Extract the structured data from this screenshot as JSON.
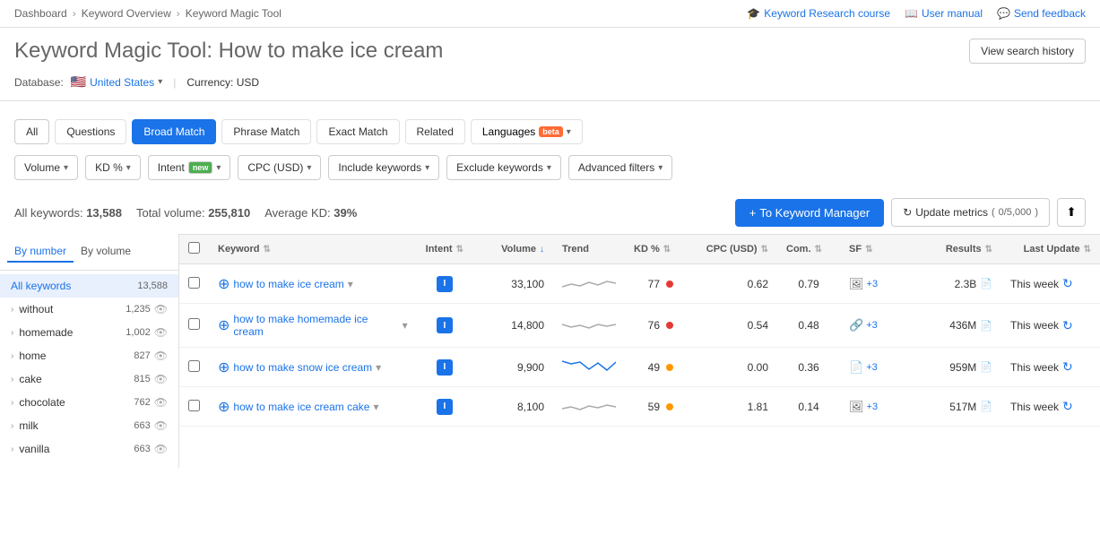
{
  "topNav": {
    "breadcrumbs": [
      "Dashboard",
      "Keyword Overview",
      "Keyword Magic Tool"
    ],
    "links": [
      {
        "label": "Keyword Research course",
        "icon": "graduation-cap"
      },
      {
        "label": "User manual",
        "icon": "book"
      },
      {
        "label": "Send feedback",
        "icon": "comment"
      }
    ]
  },
  "header": {
    "titleBold": "Keyword Magic Tool:",
    "titleLight": "How to make ice cream",
    "viewHistoryLabel": "View search history"
  },
  "database": {
    "label": "Database:",
    "country": "United States",
    "currency": "Currency: USD"
  },
  "matchTabs": [
    {
      "id": "all",
      "label": "All",
      "active": true
    },
    {
      "id": "questions",
      "label": "Questions",
      "active": false
    },
    {
      "id": "broad",
      "label": "Broad Match",
      "active": false
    },
    {
      "id": "phrase",
      "label": "Phrase Match",
      "active": false
    },
    {
      "id": "exact",
      "label": "Exact Match",
      "active": false
    },
    {
      "id": "related",
      "label": "Related",
      "active": false
    },
    {
      "id": "languages",
      "label": "Languages",
      "isBeta": true
    }
  ],
  "filters": [
    {
      "id": "volume",
      "label": "Volume",
      "hasChevron": true
    },
    {
      "id": "kd",
      "label": "KD %",
      "hasChevron": true
    },
    {
      "id": "intent",
      "label": "Intent",
      "hasChevron": true,
      "hasNew": true
    },
    {
      "id": "cpc",
      "label": "CPC (USD)",
      "hasChevron": true
    },
    {
      "id": "include",
      "label": "Include keywords",
      "hasChevron": true
    },
    {
      "id": "exclude",
      "label": "Exclude keywords",
      "hasChevron": true
    },
    {
      "id": "advanced",
      "label": "Advanced filters",
      "hasChevron": true
    }
  ],
  "stats": {
    "allKeywordsLabel": "All keywords:",
    "allKeywordsValue": "13,588",
    "totalVolumeLabel": "Total volume:",
    "totalVolumeValue": "255,810",
    "avgKdLabel": "Average KD:",
    "avgKdValue": "39%",
    "addBtnLabel": "To Keyword Manager",
    "updateBtnLabel": "Update metrics",
    "quota": "0/5,000"
  },
  "sidebar": {
    "tabs": [
      {
        "label": "By number",
        "active": true
      },
      {
        "label": "By volume",
        "active": false
      }
    ],
    "headerLabel": "All keywords",
    "headerCount": "13,588",
    "items": [
      {
        "label": "without",
        "count": "1,235"
      },
      {
        "label": "homemade",
        "count": "1,002"
      },
      {
        "label": "home",
        "count": "827"
      },
      {
        "label": "cake",
        "count": "815"
      },
      {
        "label": "chocolate",
        "count": "762"
      },
      {
        "label": "milk",
        "count": "663"
      },
      {
        "label": "vanilla",
        "count": "663"
      }
    ]
  },
  "table": {
    "columns": [
      {
        "id": "keyword",
        "label": "Keyword"
      },
      {
        "id": "intent",
        "label": "Intent"
      },
      {
        "id": "volume",
        "label": "Volume",
        "sortActive": true
      },
      {
        "id": "trend",
        "label": "Trend"
      },
      {
        "id": "kd",
        "label": "KD %"
      },
      {
        "id": "cpc",
        "label": "CPC (USD)"
      },
      {
        "id": "com",
        "label": "Com."
      },
      {
        "id": "sf",
        "label": "SF"
      },
      {
        "id": "results",
        "label": "Results"
      },
      {
        "id": "lastupdate",
        "label": "Last Update"
      }
    ],
    "rows": [
      {
        "keyword": "how to make ice cream",
        "intent": "I",
        "volume": "33,100",
        "kd": "77",
        "kdColor": "red",
        "cpc": "0.62",
        "com": "0.79",
        "sfIcons": [
          "image",
          "+3"
        ],
        "results": "2.3B",
        "resultsIcon": "doc",
        "lastUpdate": "This week"
      },
      {
        "keyword": "how to make homemade ice cream",
        "intent": "I",
        "volume": "14,800",
        "kd": "76",
        "kdColor": "red",
        "cpc": "0.54",
        "com": "0.48",
        "sfIcons": [
          "link",
          "+3"
        ],
        "results": "436M",
        "resultsIcon": "doc",
        "lastUpdate": "This week"
      },
      {
        "keyword": "how to make snow ice cream",
        "intent": "I",
        "volume": "9,900",
        "kd": "49",
        "kdColor": "orange",
        "cpc": "0.00",
        "com": "0.36",
        "sfIcons": [
          "doc",
          "+3"
        ],
        "results": "959M",
        "resultsIcon": "doc",
        "lastUpdate": "This week"
      },
      {
        "keyword": "how to make ice cream cake",
        "intent": "I",
        "volume": "8,100",
        "kd": "59",
        "kdColor": "orange",
        "cpc": "1.81",
        "com": "0.14",
        "sfIcons": [
          "image",
          "+3"
        ],
        "results": "517M",
        "resultsIcon": "doc",
        "lastUpdate": "This week"
      }
    ]
  }
}
